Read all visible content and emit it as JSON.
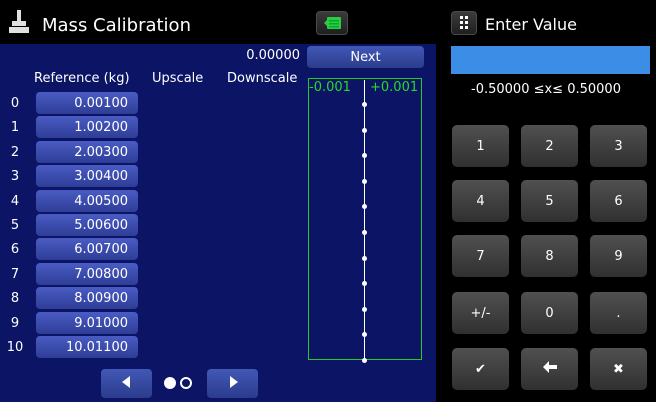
{
  "header": {
    "title": "Mass Calibration"
  },
  "readout": {
    "value": "0.00000"
  },
  "next_button": {
    "label": "Next"
  },
  "table": {
    "headers": {
      "reference": "Reference (kg)",
      "upscale": "Upscale",
      "downscale": "Downscale"
    },
    "rows": [
      {
        "index": "0",
        "reference": "0.00100"
      },
      {
        "index": "1",
        "reference": "1.00200"
      },
      {
        "index": "2",
        "reference": "2.00300"
      },
      {
        "index": "3",
        "reference": "3.00400"
      },
      {
        "index": "4",
        "reference": "4.00500"
      },
      {
        "index": "5",
        "reference": "5.00600"
      },
      {
        "index": "6",
        "reference": "6.00700"
      },
      {
        "index": "7",
        "reference": "7.00800"
      },
      {
        "index": "8",
        "reference": "8.00900"
      },
      {
        "index": "9",
        "reference": "9.01000"
      },
      {
        "index": "10",
        "reference": "10.01100"
      }
    ]
  },
  "gauge": {
    "min_label": "-0.001",
    "max_label": "+0.001",
    "min": -0.001,
    "max": 0.001
  },
  "pager": {
    "current_page": 1,
    "total_pages": 2
  },
  "keypad": {
    "title": "Enter Value",
    "entry_value": "",
    "range_text": "-0.50000 ≤x≤ 0.50000",
    "keys": [
      "1",
      "2",
      "3",
      "4",
      "5",
      "6",
      "7",
      "8",
      "9",
      "+/-",
      "0",
      "."
    ],
    "actions": {
      "enter": "✔",
      "backspace": "🡸",
      "clear": "✖"
    }
  },
  "colors": {
    "panel_blue": "#0c1565",
    "button_blue": "#3a4eae",
    "gauge_green": "#28c828",
    "entry_blue": "#3c8de6"
  }
}
